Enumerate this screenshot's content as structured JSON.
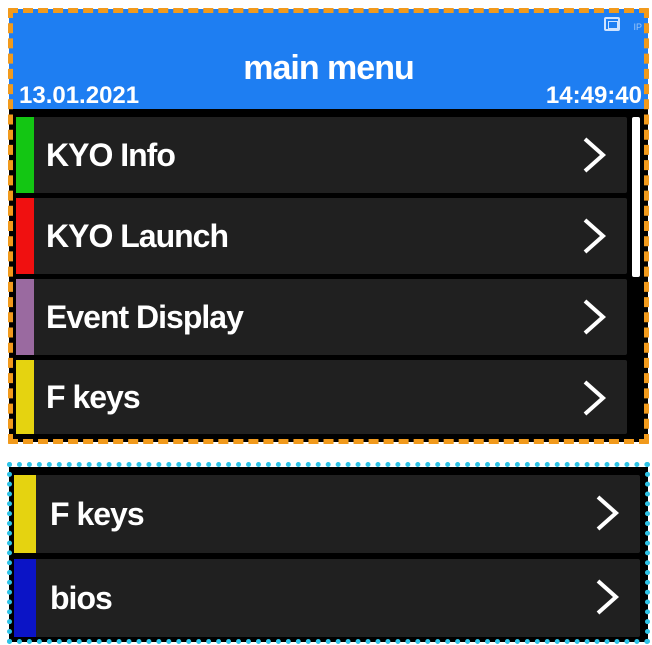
{
  "header": {
    "title": "main menu",
    "date": "13.01.2021",
    "time": "14:49:40",
    "status_text": "IP"
  },
  "colors": {
    "header_bg": "#1e7ef2",
    "highlight_top": "#f19a1c",
    "highlight_bottom": "#2ec3e6"
  },
  "menu_top": [
    {
      "label": "KYO Info",
      "color": "#13c613"
    },
    {
      "label": "KYO Launch",
      "color": "#f01010"
    },
    {
      "label": "Event Display",
      "color": "#9a6aa0"
    },
    {
      "label": "F keys",
      "color": "#e5d310"
    }
  ],
  "menu_bottom": [
    {
      "label": "F keys",
      "color": "#e5d310"
    },
    {
      "label": "bios",
      "color": "#0b14c6"
    }
  ],
  "icons": {
    "chevron": "chevron-right-icon",
    "status": "screen-icon"
  }
}
